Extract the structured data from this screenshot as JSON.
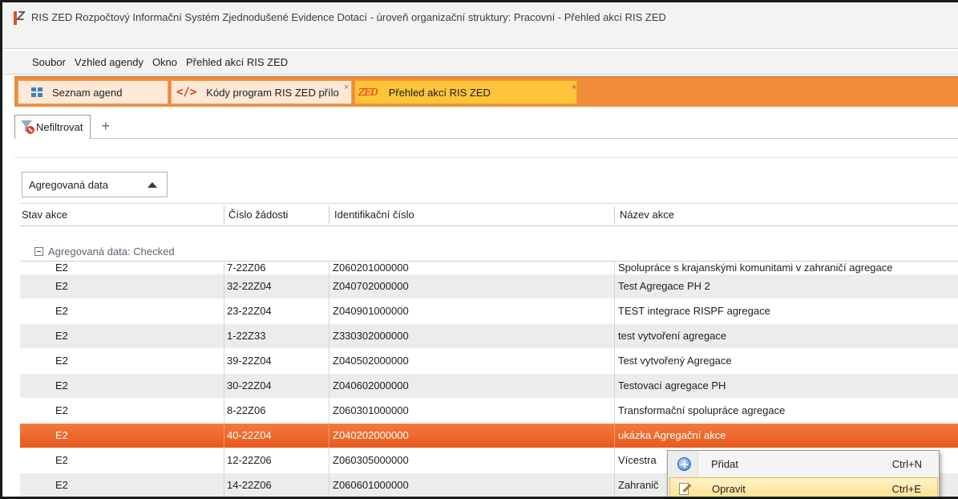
{
  "window": {
    "title": "RIS ZED Rozpočtový Informační Systém Zjednodušené Evidence Dotací - úroveň organizační struktury: Pracovní - Přehled akcí RIS ZED",
    "icon": "ris-zed-logo"
  },
  "menu": {
    "items": [
      "Soubor",
      "Vzhled agendy",
      "Okno",
      "Přehled akcí RIS ZED"
    ]
  },
  "tabs": [
    {
      "label": "Seznam agend",
      "icon": "grid-icon"
    },
    {
      "label": "Kódy program RIS ZED přílo",
      "icon": "code-icon",
      "close": "×"
    },
    {
      "label": "Přehled akcí RIS ZED",
      "icon": "zed-icon",
      "close": "×"
    }
  ],
  "filter": {
    "tab_label": "Nefiltrovat",
    "add_label": "+"
  },
  "group_chip": {
    "label": "Agregovaná data"
  },
  "columns": [
    "Stav akce",
    "Číslo žádosti",
    "Identifikační číslo",
    "Název akce"
  ],
  "group_header": "Agregovaná data: Checked",
  "rows": [
    {
      "stav": "E2",
      "cislo": "7-22Z06",
      "id": "Z060201000000",
      "nazev": "Spolupráce s krajanskými komunitami v zahraničí agregace"
    },
    {
      "stav": "E2",
      "cislo": "32-22Z04",
      "id": "Z040702000000",
      "nazev": "Test Agregace PH 2"
    },
    {
      "stav": "E2",
      "cislo": "23-22Z04",
      "id": "Z040901000000",
      "nazev": "TEST integrace RISPF agregace"
    },
    {
      "stav": "E2",
      "cislo": "1-22Z33",
      "id": "Z330302000000",
      "nazev": "test vytvoření agregace"
    },
    {
      "stav": "E2",
      "cislo": "39-22Z04",
      "id": "Z040502000000",
      "nazev": "Test vytvořený Agregace"
    },
    {
      "stav": "E2",
      "cislo": "30-22Z04",
      "id": "Z040602000000",
      "nazev": "Testovací agregace PH"
    },
    {
      "stav": "E2",
      "cislo": "8-22Z06",
      "id": "Z060301000000",
      "nazev": "Transformační spolupráce agregace"
    },
    {
      "stav": "E2",
      "cislo": "40-22Z04",
      "id": "Z040202000000",
      "nazev": "ukázka Agregační akce"
    },
    {
      "stav": "E2",
      "cislo": "12-22Z06",
      "id": "Z060305000000",
      "nazev": "Vícestra"
    },
    {
      "stav": "E2",
      "cislo": "14-22Z06",
      "id": "Z060601000000",
      "nazev": "Zahranič"
    }
  ],
  "selected_row_index": 7,
  "context_menu": {
    "items": [
      {
        "label": "Přidat",
        "shortcut": "Ctrl+N",
        "icon": "add-icon"
      },
      {
        "label": "Opravit",
        "shortcut": "Ctrl+E",
        "icon": "edit-icon"
      }
    ]
  },
  "colors": {
    "accent_orange": "#f08c3a",
    "active_tab": "#ffc43a",
    "selected_row": "#e8591e",
    "context_highlight": "#ffe08a"
  }
}
